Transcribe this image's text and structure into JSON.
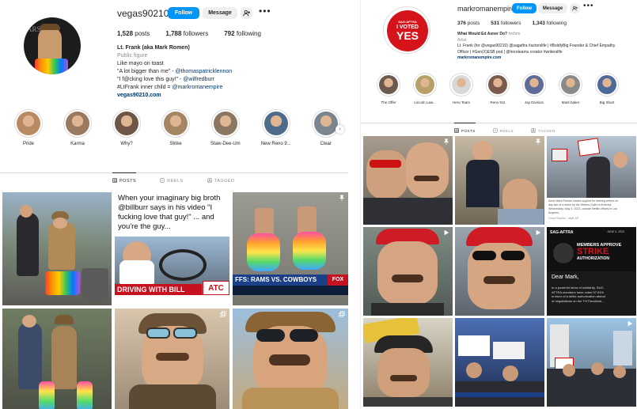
{
  "left": {
    "username": "vegas90210",
    "follow_label": "Follow",
    "message_label": "Message",
    "more_glyph": "•••",
    "stats": {
      "posts": "1,528",
      "posts_label": "posts",
      "followers": "1,788",
      "followers_label": "followers",
      "following": "792",
      "following_label": "following"
    },
    "bio": {
      "name": "Lt. Frank (aka Mark Romen)",
      "category": "Public figure",
      "line1": "Like mayo on toast",
      "line2_prefix": "\"A lot bigger than me\" - ",
      "line2_link": "@thomaspatricklennon",
      "line3_prefix": "\"I f@cking love this guy!\" - ",
      "line3_link": "@wilfredburr",
      "line4_prefix": "#LtFrank inner child = ",
      "line4_link": "@markromanempire",
      "website": "vegas90210.com"
    },
    "highlights": [
      {
        "label": "Pride",
        "color": "#b98a62"
      },
      {
        "label": "Karma",
        "color": "#9a7a5e"
      },
      {
        "label": "Why?",
        "color": "#6e5648"
      },
      {
        "label": "Strike",
        "color": "#a48662"
      },
      {
        "label": "Staw-Dee-Um",
        "color": "#8c7764"
      },
      {
        "label": "New Reno 9...",
        "color": "#4e6b8c"
      },
      {
        "label": "Clear",
        "color": "#7b8590"
      }
    ],
    "tabs": [
      {
        "label": "POSTS"
      },
      {
        "label": "REELS"
      },
      {
        "label": "TAGGED"
      }
    ],
    "post_caption_2": {
      "line1": "When your imaginary big broth",
      "line2": "@billburr says in his video \"I",
      "line3": "fucking love that guy!\" ... and",
      "line4": "you're the guy...",
      "banner": "DRIVING WITH BILL",
      "badge": "ATC"
    },
    "post_caption_3": {
      "ticker": "FFS: RAMS VS. COWBOYS",
      "badge": "FOX"
    }
  },
  "right": {
    "username": "markromanempire",
    "follow_label": "Follow",
    "message_label": "Message",
    "more_glyph": "•••",
    "avatar_text": {
      "top": "SAG·AFTRA",
      "mid": "I VOTED",
      "big": "YES"
    },
    "stats": {
      "posts": "376",
      "posts_label": "posts",
      "followers": "531",
      "followers_label": "followers",
      "following": "1,343",
      "following_label": "following"
    },
    "bio": {
      "headline": "What Would Ed Asner Do?",
      "pronouns": "he/him",
      "category": "Artist",
      "line1": "Lt. Frank (for @vegas90210) @sagaftra #actorslife | #BoldlyBig Founder & Chief Empathy",
      "line2": "Officer | #Gen(X)ESB pod | @heroteamu creator #writerslife",
      "website": "markromanempire.com"
    },
    "highlights": [
      {
        "label": "The Offer",
        "color": "#6d5a4e"
      },
      {
        "label": "Lincoln Law...",
        "color": "#b8a06a"
      },
      {
        "label": "Hero Tears",
        "color": "#d8d8d8"
      },
      {
        "label": "Reno 911",
        "color": "#7a5a4c"
      },
      {
        "label": "Jay Division",
        "color": "#5e6a98"
      },
      {
        "label": "Mark baker",
        "color": "#8a8a8a"
      },
      {
        "label": "Big Short",
        "color": "#4c6a9a"
      }
    ],
    "tabs": [
      {
        "label": "POSTS"
      },
      {
        "label": "REELS"
      },
      {
        "label": "TAGGED"
      }
    ],
    "post_caption_3": {
      "line1": "Actor Mark Roman shows support for striking writers on",
      "line2": "day two of a strike by the Writers Guild of America,",
      "line3": "Wednesday, May 3, 2023, outside Netflix offices in Los",
      "line4": "Angeles.",
      "credit": "Chris Pizzello - staff, AP"
    },
    "post_caption_6": {
      "brand": "SAG-AFTRA",
      "date": "JUNE 5, 2023",
      "l1": "MEMBERS APPROVE",
      "l2": "STRIKE",
      "l3": "AUTHORIZATION",
      "dear": "Dear Mark,",
      "body1": "In a powerful show of solidarity, SAG-",
      "body2": "AFTRA members have voted 97.91%",
      "body3": "in favor of a strike authorization ahead",
      "body4": "of negotiations on the TV/Theatrical..."
    }
  }
}
